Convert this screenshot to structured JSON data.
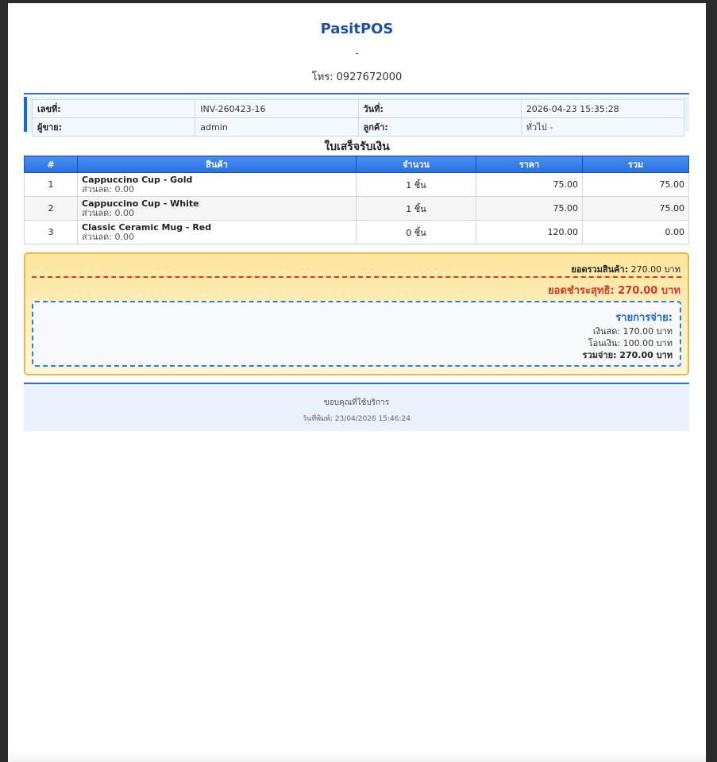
{
  "shop": {
    "name": "PasitPOS",
    "address": "-",
    "phone_label": "โทร:",
    "phone": "0927672000"
  },
  "invoice": {
    "number_label": "เลขที่:",
    "number": "INV-260423-16",
    "date_label": "วันที่:",
    "date": "2026-04-23 15:35:28",
    "seller_label": "ผู้ขาย:",
    "seller": "admin",
    "customer_label": "ลูกค้า:",
    "customer": "ทั่วไป -"
  },
  "receipt_title": "ใบเสร็จรับเงิน",
  "table": {
    "headers": [
      "#",
      "สินค้า",
      "จำนวน",
      "ราคา",
      "รวม"
    ],
    "rows": [
      {
        "num": "1",
        "name": "Cappuccino Cup - Gold",
        "discount": "ส่วนลด: 0.00",
        "qty": "1 ชิ้น",
        "price": "75.00",
        "total": "75.00"
      },
      {
        "num": "2",
        "name": "Cappuccino Cup - White",
        "discount": "ส่วนลด: 0.00",
        "qty": "1 ชิ้น",
        "price": "75.00",
        "total": "75.00"
      },
      {
        "num": "3",
        "name": "Classic Ceramic Mug - Red",
        "discount": "ส่วนลด: 0.00",
        "qty": "0 ชิ้น",
        "price": "120.00",
        "total": "0.00"
      }
    ]
  },
  "summary": {
    "subtotal_label": "ยอดรวมสินค้า:",
    "subtotal": "270.00 บาท",
    "net": "ยอดชำระสุทธิ: 270.00 บาท",
    "payments_title": "รายการจ่าย:",
    "cash": "เงินสด: 170.00 บาท",
    "transfer": "โอนเงิน: 100.00 บาท",
    "paid_total": "รวมจ่าย: 270.00 บาท"
  },
  "footer": {
    "thanks": "ขอบคุณที่ใช้บริการ",
    "printed": "วันที่พิมพ์: 23/04/2026 15:46:24"
  },
  "colors": {
    "brand_blue": "#1e4fa8",
    "header_blue": "#2a6fe0",
    "net_red": "#d23a2a",
    "summary_yellow": "#fde59c"
  }
}
